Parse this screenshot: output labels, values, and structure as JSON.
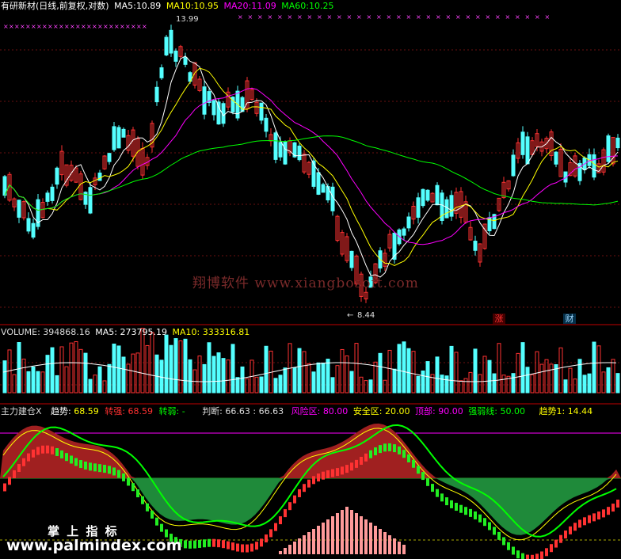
{
  "colors": {
    "bg": "#000000",
    "up": "#ff3232",
    "down": "#54ffff",
    "ma5": "#ffffff",
    "ma10": "#ffff00",
    "ma20": "#ff00ff",
    "ma60": "#00ff00",
    "red_fill": "#a02020",
    "green_fill": "#1f8a3a",
    "panel_border": "#c00000",
    "label_text": "#c0c0c0"
  },
  "price_panel": {
    "title": "有研新材(日线,前复权,对数)",
    "ma5_label": "MA5:",
    "ma5_value": "10.89",
    "ma10_label": "MA10:",
    "ma10_value": "10.95",
    "ma20_label": "MA20:",
    "ma20_value": "11.09",
    "ma60_label": "MA60:",
    "ma60_value": "10.25",
    "high_label": "13.99",
    "low_label": "8.44",
    "badge_zhang": "涨",
    "badge_cai": "财"
  },
  "volume_panel": {
    "label": "VOLUME:",
    "value": "394868.16",
    "ma5_label": "MA5:",
    "ma5_value": "273795.19",
    "ma10_label": "MA10:",
    "ma10_value": "333316.81"
  },
  "indicator_panel": {
    "name": "主力建仓X",
    "trend_label": "趋势:",
    "trend_value": "68.59",
    "turn_strong_label": "转强:",
    "turn_strong_value": "68.59",
    "turn_weak_label": "转弱:",
    "turn_weak_value": "-",
    "judge_label": "判断:",
    "judge_value": "66.63 : 66.63",
    "risk_label": "风险区:",
    "risk_value": "80.00",
    "safe_label": "安全区:",
    "safe_value": "20.00",
    "top_label": "顶部:",
    "top_value": "90.00",
    "strong_weak_label": "强弱线:",
    "strong_weak_value": "50.00",
    "trend1_label": "趋势1:",
    "trend1_value": "14.44"
  },
  "watermarks": {
    "center": "翔博软件  www.xiangbosoft.com",
    "logo_cn": "掌 上 指 标",
    "logo_url": "www.palmindex.com"
  }
}
